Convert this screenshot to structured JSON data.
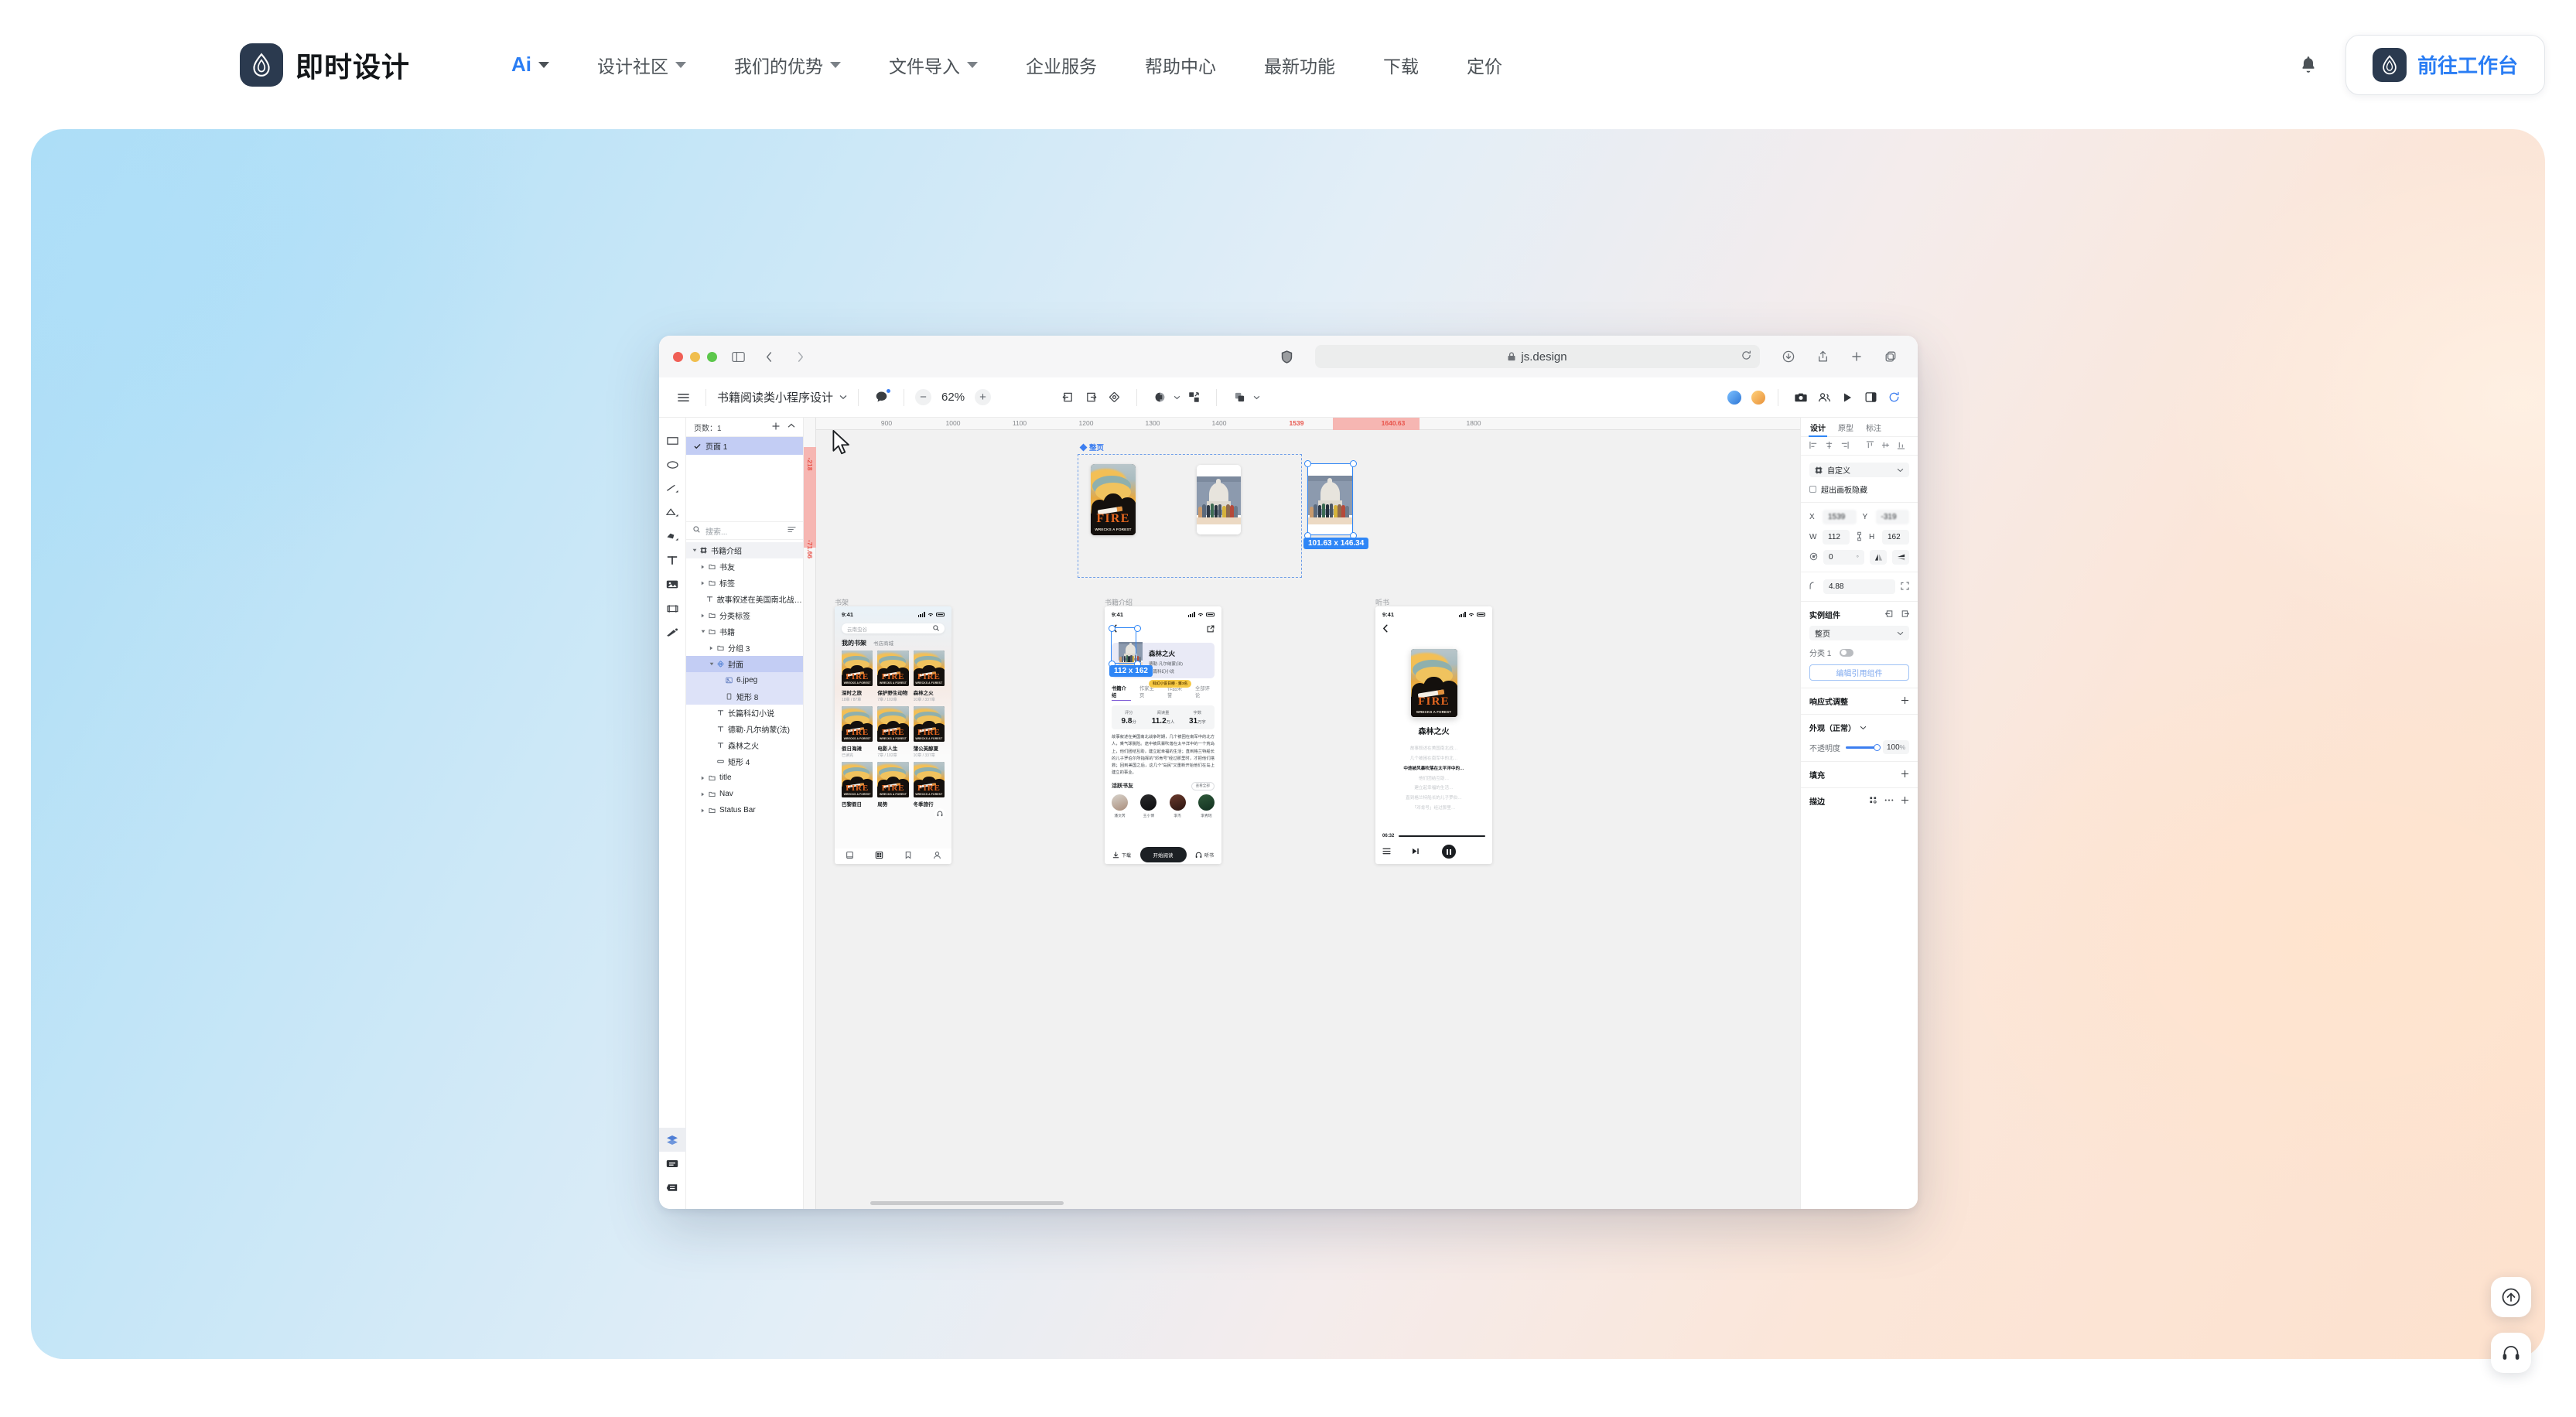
{
  "site": {
    "brand": "即时设计",
    "nav": [
      {
        "label": "Ai",
        "accent": true,
        "caret": true
      },
      {
        "label": "设计社区",
        "accent": false,
        "caret": true
      },
      {
        "label": "我们的优势",
        "accent": false,
        "caret": true
      },
      {
        "label": "文件导入",
        "accent": false,
        "caret": true
      },
      {
        "label": "企业服务",
        "accent": false,
        "caret": false
      },
      {
        "label": "帮助中心",
        "accent": false,
        "caret": false
      },
      {
        "label": "最新功能",
        "accent": false,
        "caret": false
      },
      {
        "label": "下载",
        "accent": false,
        "caret": false
      },
      {
        "label": "定价",
        "accent": false,
        "caret": false
      }
    ],
    "cta_label": "前往工作台",
    "accent_color": "#2a7df4",
    "logo_color": "#2b3a4f"
  },
  "browser": {
    "url": "js.design",
    "lock_icon": "lock-icon",
    "sidebar_icon": "sidebar-toggle-icon",
    "back_icon": "back-arrow-icon",
    "forward_icon": "forward-arrow-icon",
    "shield_icon": "shield-icon",
    "reload_icon": "reload-icon",
    "download_icon": "download-icon",
    "share_icon": "share-icon",
    "newtab_icon": "new-tab-icon",
    "tabs_icon": "tab-overview-icon"
  },
  "editor": {
    "menu_icon": "hamburger-menu-icon",
    "doc_title": "书籍阅读类小程序设计",
    "comment_icon": "comment-bubble-icon",
    "zoom": "62%",
    "zoom_out": "−",
    "zoom_in": "+",
    "toolbar_icons": [
      "export-icon",
      "import-icon",
      "component-icon",
      "mask-icon",
      "scale-icon",
      "boolean-icon"
    ],
    "present_icon": "play-icon",
    "layout_icon": "layout-icon",
    "sync_icon": "refresh-icon",
    "team_icon": "team-icon",
    "camera_icon": "camera-icon"
  },
  "rail": {
    "tools": [
      {
        "name": "rectangle-tool-icon"
      },
      {
        "name": "ellipse-tool-icon"
      },
      {
        "name": "line-tool-icon"
      },
      {
        "name": "triangle-tool-icon"
      },
      {
        "name": "polygon-tool-icon"
      },
      {
        "name": "text-tool-icon"
      },
      {
        "name": "image-tool-icon"
      },
      {
        "name": "frame-tool-icon"
      },
      {
        "name": "pen-tool-icon"
      }
    ],
    "bottom": [
      {
        "name": "layers-panel-icon",
        "active": true
      },
      {
        "name": "assets-panel-icon",
        "active": false
      },
      {
        "name": "components-panel-icon",
        "active": false
      }
    ]
  },
  "layers": {
    "pages_label": "页数：1",
    "add_icon": "plus-icon",
    "collapse_icon": "chevron-up-icon",
    "page_item": "页面 1",
    "check_icon": "check-icon",
    "search_placeholder": "搜索...",
    "search_icon": "search-icon",
    "filter_icon": "sort-filter-icon",
    "tree": [
      {
        "label": "书籍介绍",
        "indent": 0,
        "icon": "frame-icon",
        "arrow": "down",
        "state": "hl"
      },
      {
        "label": "书友",
        "indent": 1,
        "icon": "folder-icon",
        "arrow": "right",
        "state": ""
      },
      {
        "label": "标签",
        "indent": 1,
        "icon": "folder-icon",
        "arrow": "right",
        "state": ""
      },
      {
        "label": "故事叙述在美国南北战争时…",
        "indent": 1,
        "icon": "text-icon",
        "arrow": "none",
        "state": ""
      },
      {
        "label": "分类标签",
        "indent": 1,
        "icon": "folder-icon",
        "arrow": "right",
        "state": ""
      },
      {
        "label": "书籍",
        "indent": 1,
        "icon": "folder-icon",
        "arrow": "down",
        "state": ""
      },
      {
        "label": "分组 3",
        "indent": 2,
        "icon": "folder-icon",
        "arrow": "right",
        "state": ""
      },
      {
        "label": "封面",
        "indent": 2,
        "icon": "component-icon",
        "arrow": "down",
        "state": "sel"
      },
      {
        "label": "6.jpeg",
        "indent": 3,
        "icon": "image-icon",
        "arrow": "none",
        "state": "sel-soft"
      },
      {
        "label": "矩形 8",
        "indent": 3,
        "icon": "rect-icon",
        "arrow": "none",
        "state": "sel-soft"
      },
      {
        "label": "长篇科幻小说",
        "indent": 2,
        "icon": "text-icon",
        "arrow": "none",
        "state": ""
      },
      {
        "label": "德勒·凡尔纳蒙(法)",
        "indent": 2,
        "icon": "text-icon",
        "arrow": "none",
        "state": ""
      },
      {
        "label": "森林之火",
        "indent": 2,
        "icon": "text-icon",
        "arrow": "none",
        "state": ""
      },
      {
        "label": "矩形 4",
        "indent": 2,
        "icon": "rect-wide-icon",
        "arrow": "none",
        "state": ""
      },
      {
        "label": "title",
        "indent": 1,
        "icon": "folder-icon",
        "arrow": "right",
        "state": ""
      },
      {
        "label": "Nav",
        "indent": 1,
        "icon": "folder-icon",
        "arrow": "right",
        "state": ""
      },
      {
        "label": "Status Bar",
        "indent": 1,
        "icon": "folder-icon",
        "arrow": "right",
        "state": ""
      }
    ]
  },
  "canvas": {
    "ruler_h": [
      "900",
      "1000",
      "1100",
      "1200",
      "1300",
      "1400",
      "1539",
      "1640.63",
      "1800"
    ],
    "ruler_h_highlight": [
      "1539",
      "1640.63"
    ],
    "ruler_v": [
      "-218",
      "-71.66"
    ],
    "group_label": "整页",
    "selection_dim": "101.63 x 146.34",
    "artboards": [
      {
        "name": "书架"
      },
      {
        "name": "书籍介绍"
      },
      {
        "name": "听书"
      }
    ]
  },
  "shelf": {
    "time": "9:41",
    "search_value": "云南虫谷",
    "search_icon": "search-icon",
    "tab_active": "我的书架",
    "tab_inactive": "书店商城",
    "books": [
      {
        "title": "深时之旅",
        "sub": "18章 / 87章"
      },
      {
        "title": "保护野生动物",
        "sub": "7章 / 102章"
      },
      {
        "title": "森林之火",
        "sub": "10章 / 337章"
      },
      {
        "title": "假日海滩",
        "sub": "已读完"
      },
      {
        "title": "电影人生",
        "sub": "7章 / 102章"
      },
      {
        "title": "蒲公英醇夏",
        "sub": "10章 / 337章"
      },
      {
        "title": "巴黎假日",
        "sub": ""
      },
      {
        "title": "局势",
        "sub": ""
      },
      {
        "title": "冬季旅行",
        "sub": ""
      }
    ],
    "tabbar_icons": [
      "book-icon",
      "grid-icon",
      "bookmark-icon",
      "profile-icon"
    ],
    "fab_icon": "headphone-icon"
  },
  "bookinfo": {
    "time": "9:41",
    "back_icon": "back-chevron-icon",
    "share_icon": "share-box-icon",
    "cover_dim": "112 x 162",
    "title": "森林之火",
    "author": "德勒·凡尔纳蒙(法)",
    "kind": "长篇科幻小说",
    "badge": "科幻小说日榜 · 第3名",
    "tabs": [
      "书籍介绍",
      "作家主页",
      "作品荣誉",
      "全部评论"
    ],
    "stats": [
      {
        "key": "评分",
        "value": "9.8",
        "unit": "分"
      },
      {
        "key": "阅读量",
        "value": "11.2",
        "unit": "万人"
      },
      {
        "key": "字数",
        "value": "31",
        "unit": "万字"
      }
    ],
    "description": "故事叙述在美国南北战争时期，几个被困在南军中的北方人，乘气球脱险。途中被风暴吹落在太平洋中的一个荒岛上，他们团结互助，建立起幸福的生活；直到格兰特船长的儿子罗伯尔所指挥的\"邓肯号\"经过那里时，才把他们搭救；回到美国之后，这几个\"岛民\"又重新开始他们在岛上建立的事业。",
    "friends_label": "活跃书友",
    "friends_more": "查看全部",
    "friends": [
      {
        "name": "潘文芮"
      },
      {
        "name": "王小博"
      },
      {
        "name": "李杰"
      },
      {
        "name": "李秀瑶"
      }
    ],
    "download_label": "下载",
    "download_icon": "download-icon",
    "read_label": "开始阅读",
    "listen_label": "听书",
    "listen_icon": "headphone-icon"
  },
  "audiobook": {
    "time": "9:41",
    "back_icon": "back-chevron-icon",
    "title": "森林之火",
    "lines": [
      {
        "text": "故事叙述在美国南北战…",
        "current": false
      },
      {
        "text": "几个被困在南军中的北…",
        "current": false
      },
      {
        "text": "中途被风暴吹落在太平洋中的…",
        "current": true
      },
      {
        "text": "他们团结互助…",
        "current": false
      },
      {
        "text": "建立起幸福的生活…",
        "current": false
      },
      {
        "text": "直到格兰特船长的儿子罗伯…",
        "current": false
      },
      {
        "text": "「邓肯号」经过那里…",
        "current": false
      }
    ],
    "time_elapsed": "06:32",
    "list_icon": "playlist-icon",
    "next_icon": "next-track-icon",
    "pause_icon": "pause-icon"
  },
  "props": {
    "tabs": [
      "设计",
      "原型",
      "标注"
    ],
    "active_tab": "设计",
    "align_icons": [
      "align-left-icon",
      "align-center-h-icon",
      "align-right-icon",
      "align-top-icon",
      "align-middle-v-icon",
      "align-bottom-icon",
      "distribute-icon"
    ],
    "constraint_label": "自定义",
    "constraint_icon": "constraint-icon",
    "clip_label": "超出画板隐藏",
    "x_label": "X",
    "x_value": "1539",
    "y_label": "Y",
    "y_value": "-319",
    "w_label": "W",
    "w_value": "112",
    "h_label": "H",
    "h_value": "162",
    "rotation": "0",
    "rotation_unit": "°",
    "flip_h_icon": "flip-horizontal-icon",
    "flip_v_icon": "flip-vertical-icon",
    "radius_value": "4.88",
    "radius_icon": "corner-radius-icon",
    "radius_independent_icon": "independent-corners-icon",
    "instance_title": "实例组件",
    "instance_swap_icon": "swap-instance-icon",
    "instance_goto_icon": "go-to-main-icon",
    "instance_value": "整页",
    "variant_label": "分类 1",
    "variant_on": false,
    "edit_ref_label": "编辑引用组件",
    "responsive_title": "响应式调整",
    "appearance_title": "外观（正常）",
    "opacity_label": "不透明度",
    "opacity_value": "100",
    "opacity_unit": "%",
    "fill_title": "填充",
    "stroke_title": "描边",
    "plus_icon": "plus-icon",
    "grid_icon": "grid-dots-icon",
    "more_icon": "more-dots-icon"
  },
  "floating": {
    "top_icon": "scroll-to-top-icon",
    "support_icon": "headset-support-icon"
  }
}
